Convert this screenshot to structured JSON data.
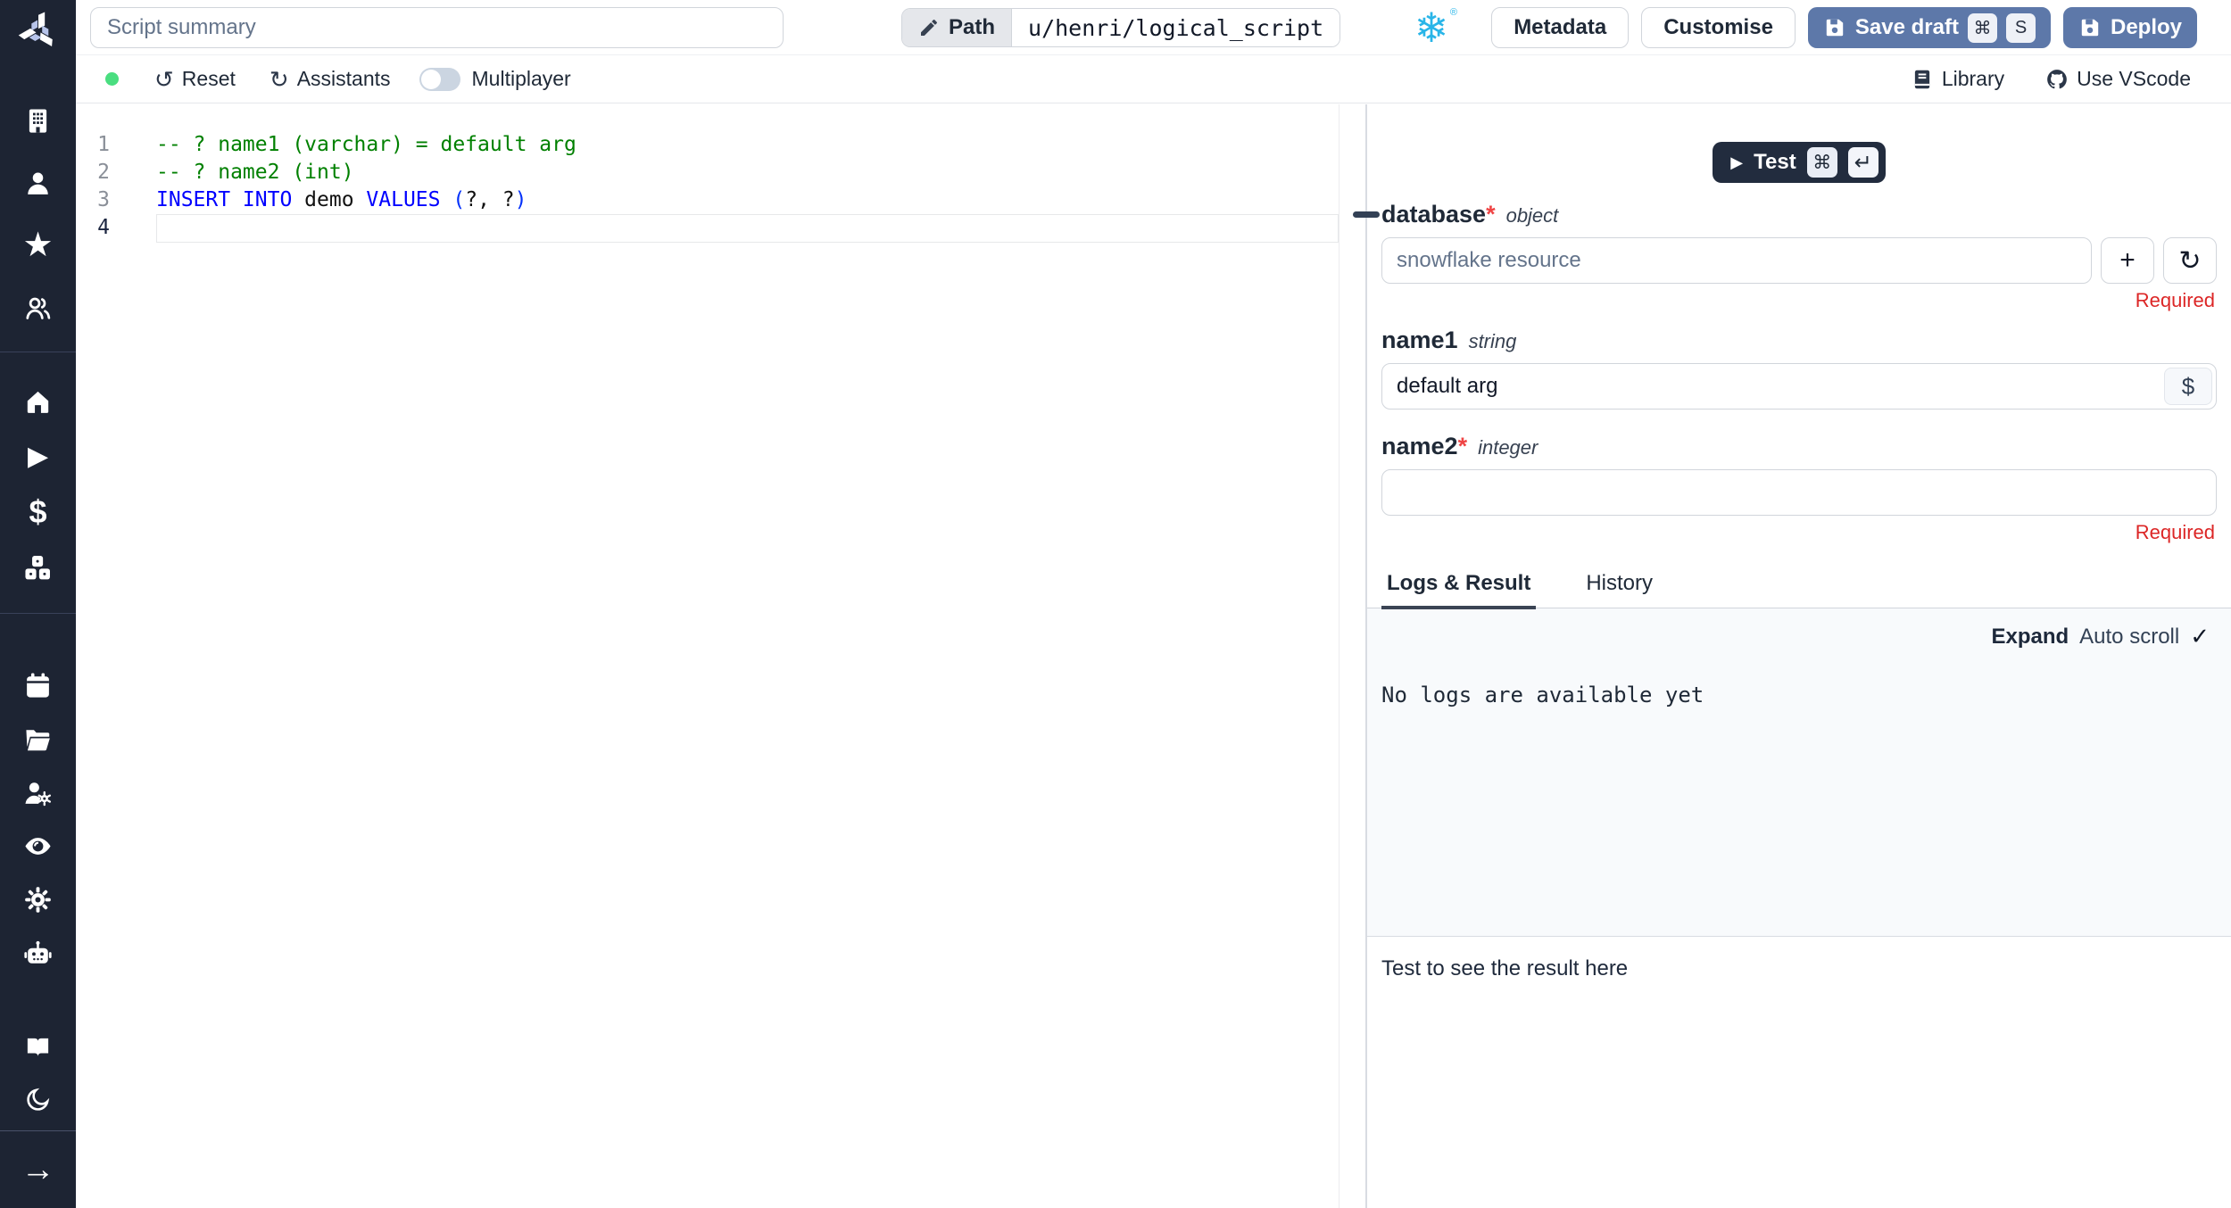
{
  "colors": {
    "sidebar_bg": "#1d2433",
    "accent_blue": "#5d78a9",
    "snowflake_blue": "#29b5e8",
    "status_green": "#4ade80",
    "required_red": "#dc2626",
    "comment_green": "#008000",
    "keyword_blue": "#0000ff"
  },
  "sidebar": {
    "logo": "windmill-logo",
    "groups": [
      [
        "building-icon",
        "user-icon",
        "star-icon",
        "users-icon"
      ],
      [
        "home-icon",
        "play-icon",
        "dollar-icon",
        "cubes-icon"
      ],
      [
        "calendar-icon",
        "folder-icon",
        "user-cog-icon",
        "eye-icon",
        "gear-icon",
        "robot-icon"
      ]
    ],
    "bottom": [
      "book-open-icon",
      "moon-icon"
    ],
    "footer": [
      "arrow-right-icon"
    ]
  },
  "topbar": {
    "summary_placeholder": "Script summary",
    "path_label": "Path",
    "path_value": "u/henri/logical_script",
    "metadata_label": "Metadata",
    "customise_label": "Customise",
    "save_draft_label": "Save draft",
    "save_kbd": [
      "⌘",
      "S"
    ],
    "deploy_label": "Deploy"
  },
  "toolbar": {
    "reset_label": "Reset",
    "reset_icon": "↺",
    "assistants_label": "Assistants",
    "assistants_icon": "↻",
    "multiplayer_label": "Multiplayer",
    "library_label": "Library",
    "vscode_label": "Use VScode"
  },
  "editor": {
    "active_line": 4,
    "lines": [
      {
        "num": 1,
        "segments": [
          {
            "text": "-- ? name1 (varchar) = default arg",
            "type": "comment"
          }
        ]
      },
      {
        "num": 2,
        "segments": [
          {
            "text": "-- ? name2 (int)",
            "type": "comment"
          }
        ]
      },
      {
        "num": 3,
        "segments": [
          {
            "text": "INSERT INTO",
            "type": "keyword"
          },
          {
            "text": " demo ",
            "type": "plain"
          },
          {
            "text": "VALUES",
            "type": "keyword"
          },
          {
            "text": " ",
            "type": "plain"
          },
          {
            "text": "(",
            "type": "paren"
          },
          {
            "text": "?, ?",
            "type": "plain"
          },
          {
            "text": ")",
            "type": "paren"
          }
        ]
      },
      {
        "num": 4,
        "segments": []
      }
    ]
  },
  "runner": {
    "test_label": "Test",
    "test_play": "▶",
    "test_kbd": [
      "⌘",
      "↵"
    ],
    "fields": [
      {
        "label": "database",
        "star": "*",
        "type": "object",
        "placeholder": "snowflake resource",
        "required_msg": "Required",
        "plus": "+",
        "refresh": "↻"
      },
      {
        "label": "name1",
        "type": "string",
        "value": "default arg",
        "suffix": "$"
      },
      {
        "label": "name2",
        "star": "*",
        "type": "integer",
        "required_msg": "Required"
      }
    ],
    "tabs": [
      "Logs & Result",
      "History"
    ],
    "logs": {
      "expand_label": "Expand",
      "autoscroll_label": "Auto scroll",
      "autoscroll_check": "✓",
      "empty_text": "No logs are available yet"
    },
    "result_placeholder": "Test to see the result here"
  }
}
